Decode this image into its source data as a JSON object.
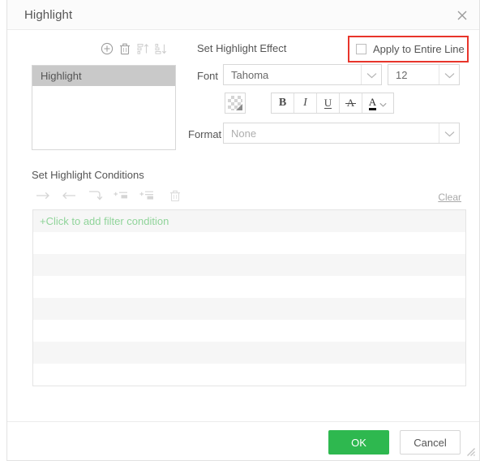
{
  "dialog": {
    "title": "Highlight",
    "close_icon": "close-icon"
  },
  "left_panel": {
    "toolbar": [
      {
        "icon": "add-circle-icon",
        "label": "Add"
      },
      {
        "icon": "trash-icon",
        "label": "Delete"
      },
      {
        "icon": "sort-ascending-icon",
        "label": "Move Up"
      },
      {
        "icon": "sort-descending-icon",
        "label": "Move Down"
      }
    ],
    "list_items": [
      {
        "label": "Highlight",
        "selected": true
      }
    ]
  },
  "effect": {
    "section_title": "Set Highlight Effect",
    "apply_entire_line": {
      "label": "Apply to Entire Line",
      "checked": false,
      "annotation_color": "#e8352b"
    },
    "font_label": "Font",
    "font_value": "Tahoma",
    "font_size_value": "12",
    "format_label": "Format",
    "format_value": "None",
    "color_swatch": "transparent-swatch-icon",
    "style_buttons": [
      {
        "icon": "bold-icon",
        "glyph": "B"
      },
      {
        "icon": "italic-icon",
        "glyph": "I"
      },
      {
        "icon": "underline-icon",
        "glyph": "U"
      },
      {
        "icon": "strikethrough-icon",
        "glyph": "A"
      },
      {
        "icon": "font-color-icon",
        "glyph": "A"
      }
    ]
  },
  "conditions": {
    "section_title": "Set Highlight Conditions",
    "toolbar": [
      {
        "icon": "arrow-right-icon",
        "label": "Indent Right"
      },
      {
        "icon": "arrow-left-icon",
        "label": "Indent Left"
      },
      {
        "icon": "return-arrow-icon",
        "label": "Move To Next Line"
      },
      {
        "icon": "add-condition-icon",
        "label": "Add Condition"
      },
      {
        "icon": "add-group-icon",
        "label": "Add Group"
      },
      {
        "icon": "trash-icon",
        "label": "Delete Condition"
      }
    ],
    "clear_label": "Clear",
    "add_filter_label": "+Click to add filter condition",
    "add_filter_color": "#90d49a",
    "empty_row_count": 6
  },
  "footer": {
    "ok_label": "OK",
    "cancel_label": "Cancel",
    "ok_color": "#2eb84f",
    "resize_grip": "resize-grip-icon"
  }
}
